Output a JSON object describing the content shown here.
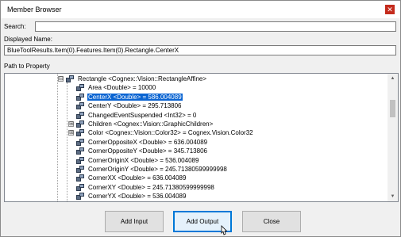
{
  "window": {
    "title": "Member Browser",
    "close_glyph": "✕"
  },
  "search": {
    "label": "Search:",
    "value": ""
  },
  "displayed_name": {
    "label": "Displayed Name:",
    "value": "BlueToolResults.Item(0).Features.Item(0).Rectangle.CenterX"
  },
  "path": {
    "label": "Path to Property"
  },
  "tree": {
    "rows": [
      {
        "text": "Rectangle <Cognex::Vision::RectangleAffine>",
        "expander": "⊟",
        "icon": "object-node-icon"
      },
      {
        "text": "Area <Double> = 10000",
        "icon": "property-node-icon"
      },
      {
        "text": "CenterX <Double> = 586.004089",
        "icon": "property-node-icon",
        "selected": true
      },
      {
        "text": "CenterY <Double> = 295.713806",
        "icon": "property-node-icon"
      },
      {
        "text": "ChangedEventSuspended <Int32> = 0",
        "icon": "property-node-icon"
      },
      {
        "text": "Children <Cognex::Vision::GraphicChildren>",
        "expander": "⊞",
        "icon": "object-node-icon"
      },
      {
        "text": "Color <Cognex::Vision::Color32> = Cognex.Vision.Color32",
        "expander": "⊞",
        "icon": "object-node-icon"
      },
      {
        "text": "CornerOppositeX <Double> = 636.004089",
        "icon": "property-node-icon"
      },
      {
        "text": "CornerOppositeY <Double> = 345.713806",
        "icon": "property-node-icon"
      },
      {
        "text": "CornerOriginX <Double> = 536.004089",
        "icon": "property-node-icon"
      },
      {
        "text": "CornerOriginY <Double> = 245.71380599999998",
        "icon": "property-node-icon"
      },
      {
        "text": "CornerXX <Double> = 636.004089",
        "icon": "property-node-icon"
      },
      {
        "text": "CornerXY <Double> = 245.71380599999998",
        "icon": "property-node-icon"
      },
      {
        "text": "CornerYX <Double> = 536.004089",
        "icon": "property-node-icon"
      }
    ],
    "scroll_up_glyph": "▲",
    "scroll_down_glyph": "▼"
  },
  "buttons": {
    "add_input": "Add Input",
    "add_output": "Add Output",
    "close": "Close"
  },
  "colors": {
    "selection": "#0a64d2",
    "default_button_border": "#0078d7",
    "close_button": "#c42b1c"
  }
}
